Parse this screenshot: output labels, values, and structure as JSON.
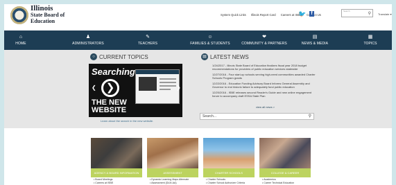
{
  "header": {
    "logo": {
      "line1": "Illinois",
      "line2": "State Board of",
      "line3": "Education"
    },
    "top_links": [
      "System Quick Links",
      "Illinois Report Card",
      "Careers at ISBE",
      "Contact Us"
    ],
    "search_label": "Search",
    "translate": "Translate"
  },
  "nav": {
    "items": [
      {
        "label": "HOME",
        "icon": "home-icon"
      },
      {
        "label": "ADMINISTRATORS",
        "icon": "person-icon"
      },
      {
        "label": "TEACHERS",
        "icon": "teacher-icon"
      },
      {
        "label": "FAMILIES & STUDENTS",
        "icon": "family-icon"
      },
      {
        "label": "COMMUNITY & PARTNERS",
        "icon": "handshake-icon"
      },
      {
        "label": "NEWS & MEDIA",
        "icon": "news-icon"
      },
      {
        "label": "TOPICS",
        "icon": "grid-icon"
      }
    ]
  },
  "current_topics": {
    "title": "CURRENT TOPICS",
    "slide": {
      "line1": "Searching",
      "line2": "THE NEW",
      "line3": "WEBSITE"
    },
    "caption": "Learn about the search in the new website."
  },
  "latest_news": {
    "title": "LATEST NEWS",
    "items": [
      "1/24/2017 - Illinois State Board of Education finalizes fiscal year 2018 budget recommendations for providers of public education services statewide",
      "12/27/2016 - Four start-up schools serving high-need communities awarded Charter Schools Program grants",
      "12/22/2016 - Education Funding Advisory Board Informs General Assembly and Governor to end historic failure to adequately fund public education",
      "12/20/2016 - ISBE releases second Reader's Guide and new online engagement forum to accompany draft ESSA State Plan"
    ],
    "view_all": "view all news >",
    "search_placeholder": "Search..."
  },
  "cards": [
    {
      "title": "AGENCY & BOARD INFORMATION",
      "items": [
        "Board Meetings",
        "Careers at ISBE"
      ],
      "color": "#bcd35f"
    },
    {
      "title": "ASSESSMENT",
      "items": [
        "Dynamic Learning Maps Alternate",
        "Assessment (DLM-AA)"
      ],
      "color": "#bcd35f"
    },
    {
      "title": "CHARTER SCHOOLS",
      "items": [
        "Charter Schools",
        "Charter School Authorizer Criteria"
      ],
      "color": "#bcd35f"
    },
    {
      "title": "COLLEGE & CAREER",
      "items": [
        "Academics",
        "Career Technical Education"
      ],
      "color": "#bcd35f"
    }
  ],
  "colors": {
    "nav": "#1d3d54",
    "band": "#bcd35f",
    "page_bg": "#cfe6ea"
  }
}
